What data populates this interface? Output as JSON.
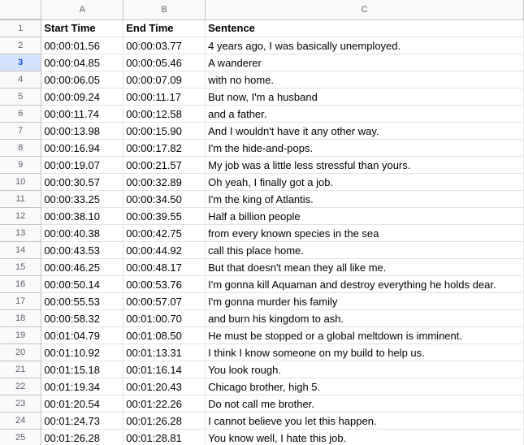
{
  "columns": [
    "A",
    "B",
    "C"
  ],
  "header": {
    "start": "Start Time",
    "end": "End Time",
    "sentence": "Sentence"
  },
  "rows": [
    {
      "n": "2",
      "start": "00:00:01.56",
      "end": "00:00:03.77",
      "text": "4 years ago, I was basically unemployed."
    },
    {
      "n": "3",
      "start": "00:00:04.85",
      "end": "00:00:05.46",
      "text": "A wanderer"
    },
    {
      "n": "4",
      "start": "00:00:06.05",
      "end": "00:00:07.09",
      "text": "with no home."
    },
    {
      "n": "5",
      "start": "00:00:09.24",
      "end": "00:00:11.17",
      "text": "But now, I'm a husband"
    },
    {
      "n": "6",
      "start": "00:00:11.74",
      "end": "00:00:12.58",
      "text": "and a father."
    },
    {
      "n": "7",
      "start": "00:00:13.98",
      "end": "00:00:15.90",
      "text": "And I wouldn't have it any other way."
    },
    {
      "n": "8",
      "start": "00:00:16.94",
      "end": "00:00:17.82",
      "text": "I'm the hide-and-pops."
    },
    {
      "n": "9",
      "start": "00:00:19.07",
      "end": "00:00:21.57",
      "text": "My job was a little less stressful than yours."
    },
    {
      "n": "10",
      "start": "00:00:30.57",
      "end": "00:00:32.89",
      "text": "Oh yeah, I finally got a job."
    },
    {
      "n": "11",
      "start": "00:00:33.25",
      "end": "00:00:34.50",
      "text": "I'm the king of Atlantis."
    },
    {
      "n": "12",
      "start": "00:00:38.10",
      "end": "00:00:39.55",
      "text": "Half a billion people"
    },
    {
      "n": "13",
      "start": "00:00:40.38",
      "end": "00:00:42.75",
      "text": "from every known species in the sea"
    },
    {
      "n": "14",
      "start": "00:00:43.53",
      "end": "00:00:44.92",
      "text": "call this place home."
    },
    {
      "n": "15",
      "start": "00:00:46.25",
      "end": "00:00:48.17",
      "text": "But that doesn't mean they all like me."
    },
    {
      "n": "16",
      "start": "00:00:50.14",
      "end": "00:00:53.76",
      "text": "I'm gonna kill Aquaman and destroy everything he holds dear."
    },
    {
      "n": "17",
      "start": "00:00:55.53",
      "end": "00:00:57.07",
      "text": "I'm gonna murder his family"
    },
    {
      "n": "18",
      "start": "00:00:58.32",
      "end": "00:01:00.70",
      "text": "and burn his kingdom to ash."
    },
    {
      "n": "19",
      "start": "00:01:04.79",
      "end": "00:01:08.50",
      "text": "He must be stopped or a global meltdown is imminent."
    },
    {
      "n": "20",
      "start": "00:01:10.92",
      "end": "00:01:13.31",
      "text": "I think I know someone on my build to help us."
    },
    {
      "n": "21",
      "start": "00:01:15.18",
      "end": "00:01:16.14",
      "text": "You look rough."
    },
    {
      "n": "22",
      "start": "00:01:19.34",
      "end": "00:01:20.43",
      "text": "Chicago brother, high 5."
    },
    {
      "n": "23",
      "start": "00:01:20.54",
      "end": "00:01:22.26",
      "text": "Do not call me brother."
    },
    {
      "n": "24",
      "start": "00:01:24.73",
      "end": "00:01:26.28",
      "text": "I cannot believe you let this happen."
    },
    {
      "n": "25",
      "start": "00:01:26.28",
      "end": "00:01:28.81",
      "text": "You know well, I hate this job."
    }
  ],
  "selected_row": "3"
}
